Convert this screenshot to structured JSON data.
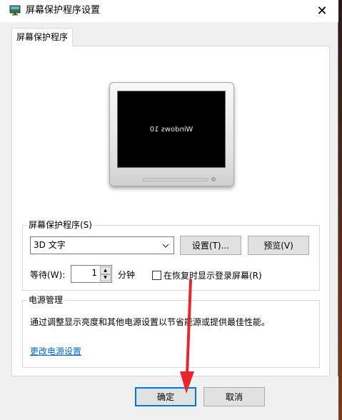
{
  "window": {
    "title": "屏幕保护程序设置",
    "close_glyph": "✕"
  },
  "tabs": [
    {
      "label": "屏幕保护程序"
    }
  ],
  "preview": {
    "screen_text": "Windows 10"
  },
  "screensaver_group": {
    "label": "屏幕保护程序(S)",
    "selected": "3D 文字",
    "settings_button": "设置(T)...",
    "preview_button": "预览(V)",
    "wait_label": "等待(W):",
    "wait_value": "1",
    "wait_unit": "分钟",
    "resume_checkbox_label": "在恢复时显示登录屏幕(R)",
    "resume_checked": false
  },
  "power_group": {
    "label": "电源管理",
    "description": "通过调整显示亮度和其他电源设置以节省能源或提供最佳性能。",
    "link": "更改电源设置"
  },
  "footer": {
    "ok_button": "确定",
    "cancel_button": "取消"
  },
  "colors": {
    "link": "#0066cc",
    "annotation_arrow": "#e8262d",
    "default_button_border": "#0078d7"
  }
}
